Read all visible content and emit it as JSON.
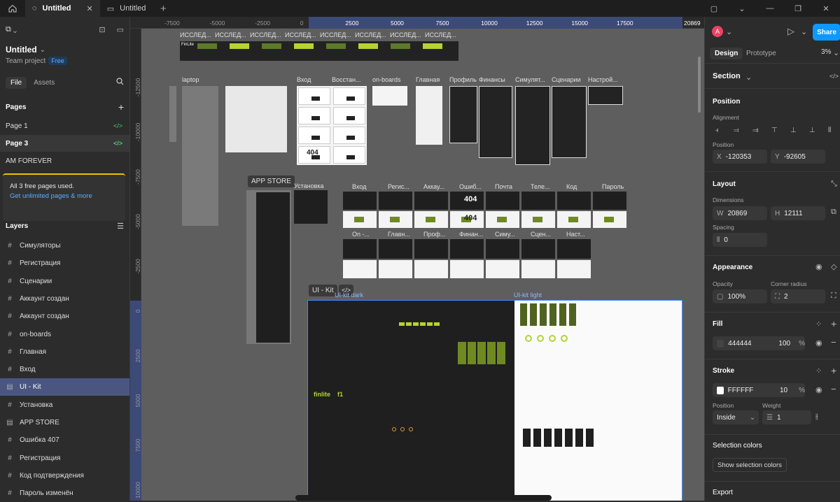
{
  "tabs": [
    {
      "title": "Untitled",
      "active": true
    },
    {
      "title": "Untitled",
      "active": false
    }
  ],
  "project": {
    "title": "Untitled",
    "team": "Team project",
    "plan": "Free"
  },
  "left_tabs": {
    "file": "File",
    "assets": "Assets"
  },
  "pages": {
    "header": "Pages",
    "items": [
      {
        "label": "Page 1",
        "selected": false,
        "dev": true
      },
      {
        "label": "Page 3",
        "selected": true,
        "dev": true
      },
      {
        "label": "AM FOREVER",
        "selected": false,
        "dev": false
      }
    ]
  },
  "notice": {
    "text": "All 3 free pages used.",
    "link": "Get unlimited pages & more"
  },
  "layers": {
    "header": "Layers",
    "items": [
      {
        "label": "Симуляторы",
        "icon": "frame-icon",
        "selected": false
      },
      {
        "label": "Регистрация",
        "icon": "frame-icon",
        "selected": false
      },
      {
        "label": "Сценарии",
        "icon": "frame-icon",
        "selected": false
      },
      {
        "label": "Аккаунт создан",
        "icon": "frame-icon",
        "selected": false
      },
      {
        "label": "Аккаунт создан",
        "icon": "frame-icon",
        "selected": false
      },
      {
        "label": "on-boards",
        "icon": "frame-icon",
        "selected": false
      },
      {
        "label": "Главная",
        "icon": "frame-icon",
        "selected": false
      },
      {
        "label": "Вход",
        "icon": "frame-icon",
        "selected": false
      },
      {
        "label": "UI - Kit",
        "icon": "section-icon",
        "selected": true
      },
      {
        "label": "Установка",
        "icon": "frame-icon",
        "selected": false
      },
      {
        "label": "APP STORE",
        "icon": "section-icon",
        "selected": false
      },
      {
        "label": "Ошибка 407",
        "icon": "frame-icon",
        "selected": false
      },
      {
        "label": "Регистрация",
        "icon": "frame-icon",
        "selected": false
      },
      {
        "label": "Код подтверждения",
        "icon": "frame-icon",
        "selected": false
      },
      {
        "label": "Пароль изменён",
        "icon": "frame-icon",
        "selected": false
      }
    ]
  },
  "ruler": {
    "h_ticks": [
      "-7500",
      "-5000",
      "-2500",
      "0",
      "2500",
      "5000",
      "7500",
      "10000",
      "12500",
      "15000",
      "17500"
    ],
    "h_end": "20869",
    "v_ticks": [
      "-12500",
      "-10000",
      "-7500",
      "-5000",
      "-2500",
      "0",
      "2500",
      "5000",
      "7500",
      "10000"
    ]
  },
  "canvas": {
    "top_labels": [
      "ИССЛЕД...",
      "ИССЛЕД...",
      "ИССЛЕД...",
      "ИССЛЕД...",
      "ИССЛЕД...",
      "ИССЛЕД...",
      "ИССЛЕД...",
      "ИССЛЕД..."
    ],
    "row2_labels": [
      "laptop",
      "Вход",
      "Восстан...",
      "on-boards",
      "Главная",
      "Профиль",
      "Финансы",
      "Симулят...",
      "Сценарии",
      "Настрой..."
    ],
    "appstore_label": "APP STORE",
    "install_label": "Установка",
    "row3_labels": [
      "Вход",
      "Регис...",
      "Аккау...",
      "Ошиб...",
      "Почта",
      "Теле...",
      "Код",
      "Пароль"
    ],
    "row4_labels": [
      "On -...",
      "Главн...",
      "Проф...",
      "Финан...",
      "Симу...",
      "Сцен...",
      "Наст..."
    ],
    "code_404": "404",
    "uikit_tag": "UI - Kit",
    "uikit_dark_label": "UI-kit dark",
    "uikit_light_label": "UI-kit light",
    "finlite": "FinLite",
    "kit_logo": "finlite",
    "kit_code": "f1"
  },
  "right": {
    "avatar": "A",
    "share": "Share",
    "tabs": {
      "design": "Design",
      "prototype": "Prototype"
    },
    "zoom": "3%",
    "section": "Section",
    "position": {
      "title": "Position",
      "alignment": "Alignment",
      "position_label": "Position",
      "x": "-120353",
      "y": "-92605"
    },
    "layout": {
      "title": "Layout",
      "dimensions": "Dimensions",
      "w": "20869",
      "h": "12111",
      "spacing_label": "Spacing",
      "spacing": "0"
    },
    "appearance": {
      "title": "Appearance",
      "opacity_label": "Opacity",
      "opacity": "100%",
      "radius_label": "Corner radius",
      "radius": "2"
    },
    "fill": {
      "title": "Fill",
      "hex": "444444",
      "opacity": "100",
      "pct": "%",
      "color": "#444444"
    },
    "stroke": {
      "title": "Stroke",
      "hex": "FFFFFF",
      "opacity": "10",
      "pct": "%",
      "pos_label": "Position",
      "weight_label": "Weight",
      "position": "Inside",
      "weight": "1",
      "color": "#ffffff"
    },
    "selection_colors": {
      "title": "Selection colors",
      "button": "Show selection colors"
    },
    "export": {
      "title": "Export"
    }
  },
  "accent": "#b5d334"
}
